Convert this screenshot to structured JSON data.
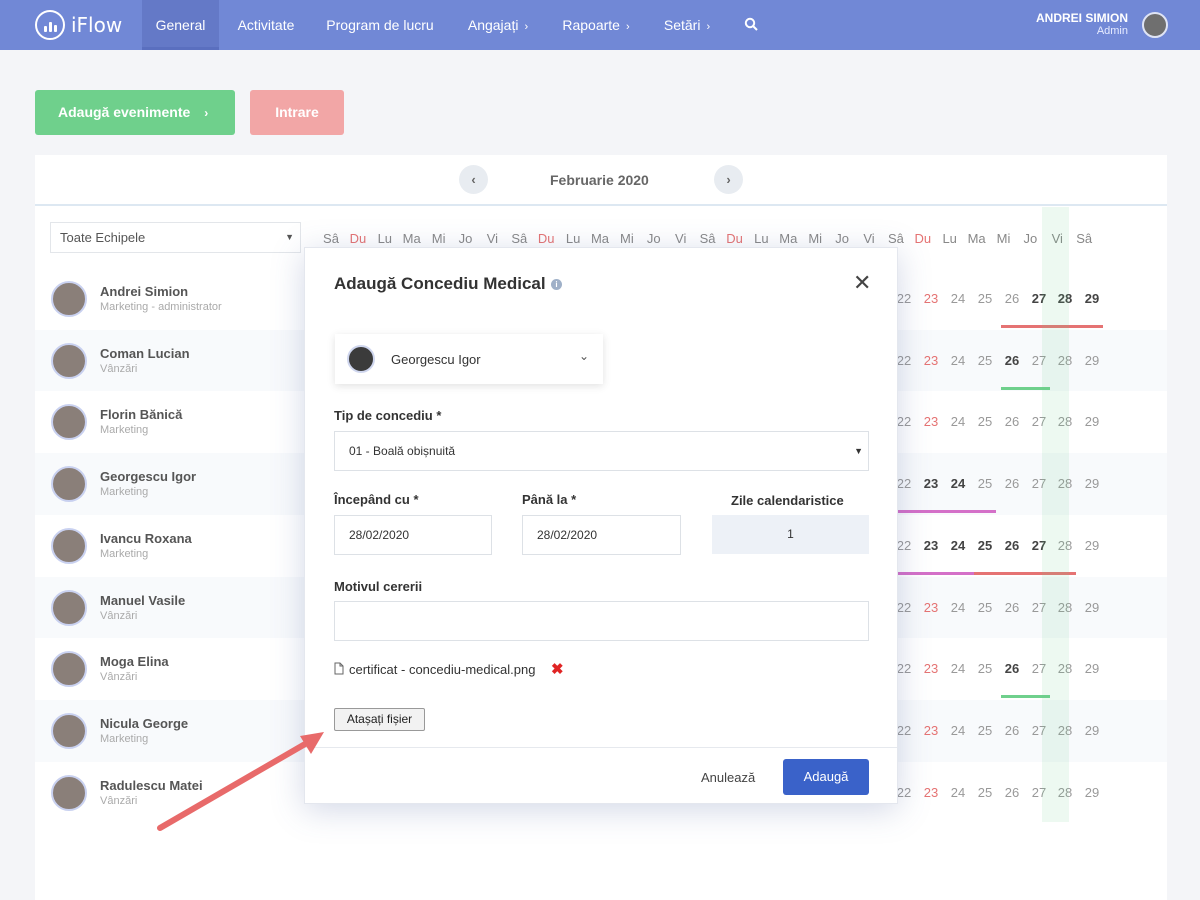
{
  "app": {
    "name": "iFlow"
  },
  "nav": {
    "items": [
      {
        "label": "General",
        "active": true
      },
      {
        "label": "Activitate"
      },
      {
        "label": "Program de lucru"
      },
      {
        "label": "Angajați",
        "has_submenu": true
      },
      {
        "label": "Rapoarte",
        "has_submenu": true
      },
      {
        "label": "Setări",
        "has_submenu": true
      }
    ],
    "search_icon": "search-icon",
    "user_name": "ANDREI SIMION",
    "user_role": "Admin"
  },
  "actions": {
    "add_events": "Adaugă evenimente",
    "entry": "Intrare"
  },
  "calendar": {
    "month": "Februarie 2020",
    "team_filter": "Toate Echipele",
    "header_days": [
      "Sâ",
      "Du",
      "Lu",
      "Ma",
      "Mi",
      "Jo",
      "Vi",
      "Sâ",
      "Du",
      "Lu",
      "Ma",
      "Mi",
      "Jo",
      "Vi",
      "Sâ",
      "Du",
      "Lu",
      "Ma",
      "Mi",
      "Jo",
      "Vi",
      "Sâ",
      "Du",
      "Lu",
      "Ma",
      "Mi",
      "Jo",
      "Vi",
      "Sâ"
    ],
    "visible_dates": [
      "22",
      "23",
      "24",
      "25",
      "26",
      "27",
      "28",
      "29"
    ],
    "employees": [
      {
        "name": "Andrei Simion",
        "role": "Marketing - administrator"
      },
      {
        "name": "Coman Lucian",
        "role": "Vânzări"
      },
      {
        "name": "Florin Bănică",
        "role": "Marketing"
      },
      {
        "name": "Georgescu Igor",
        "role": "Marketing"
      },
      {
        "name": "Ivancu Roxana",
        "role": "Marketing"
      },
      {
        "name": "Manuel Vasile",
        "role": "Vânzări"
      },
      {
        "name": "Moga Elina",
        "role": "Vânzări"
      },
      {
        "name": "Nicula George",
        "role": "Marketing"
      },
      {
        "name": "Radulescu Matei",
        "role": "Vânzări"
      }
    ],
    "colors": {
      "weekend": "#e57373",
      "green_bar": "#6fd08c",
      "red_bar": "#e57373",
      "pink_bar": "#d470c8",
      "blue_bar": "#5bb5e6"
    }
  },
  "modal": {
    "title": "Adaugă Concediu Medical",
    "employee": "Georgescu Igor",
    "leave_type_label": "Tip de concediu *",
    "leave_type_value": "01 - Boală obișnuită",
    "start_label": "Începând cu *",
    "start_value": "28/02/2020",
    "end_label": "Până la *",
    "end_value": "28/02/2020",
    "days_label": "Zile calendaristice",
    "days_value": "1",
    "reason_label": "Motivul cererii",
    "reason_value": "",
    "file_name": "certificat - concediu-medical.png",
    "attach_button": "Atașați fișier",
    "cancel_button": "Anulează",
    "submit_button": "Adaugă"
  }
}
